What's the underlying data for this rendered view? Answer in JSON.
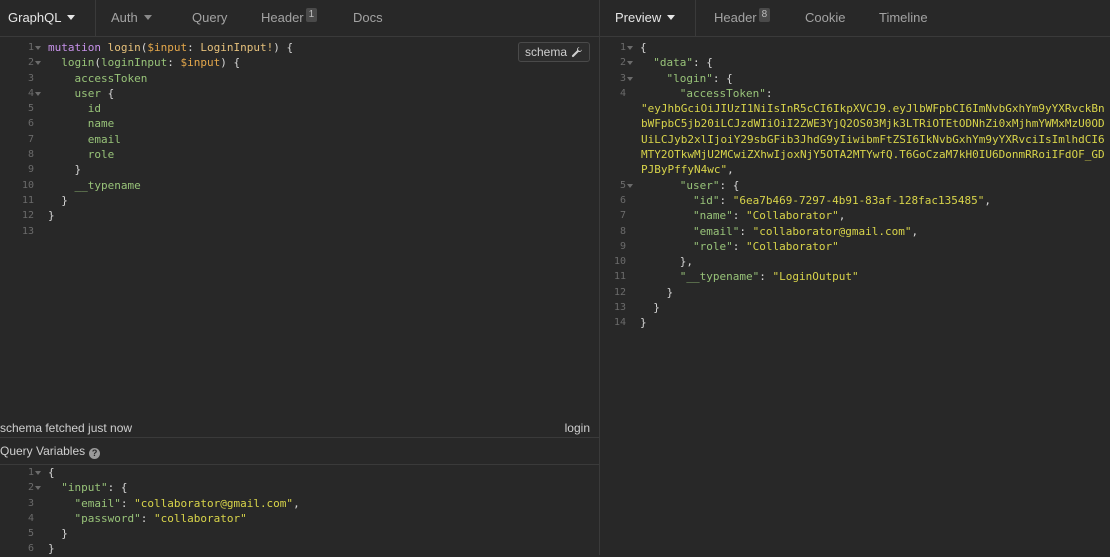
{
  "left_tabs": {
    "graphql": "GraphQL",
    "auth": "Auth",
    "query": "Query",
    "header": "Header",
    "header_count": "1",
    "docs": "Docs"
  },
  "right_tabs": {
    "preview": "Preview",
    "header": "Header",
    "header_count": "8",
    "cookie": "Cookie",
    "timeline": "Timeline"
  },
  "schema_button": "schema",
  "status": {
    "left": "schema fetched just now",
    "right": "login"
  },
  "variables_header": "Query Variables",
  "query": {
    "line_numbers": [
      "1",
      "2",
      "3",
      "4",
      "5",
      "6",
      "7",
      "8",
      "9",
      "10",
      "11",
      "12",
      "13"
    ],
    "mutation_kw": "mutation",
    "op_name": "login",
    "var_name": "$input",
    "var_type": "LoginInput!",
    "field_login": "login",
    "arg_name": "loginInput",
    "fields": [
      "accessToken",
      "user",
      "id",
      "name",
      "email",
      "role",
      "__typename"
    ]
  },
  "variables": {
    "line_numbers": [
      "1",
      "2",
      "3",
      "4",
      "5",
      "6"
    ],
    "input_key": "\"input\"",
    "email_key": "\"email\"",
    "email_value": "\"collaborator@gmail.com\"",
    "password_key": "\"password\"",
    "password_value": "\"collaborator\""
  },
  "response": {
    "line_numbers": [
      "1",
      "2",
      "3",
      "4",
      "5",
      "6",
      "7",
      "8",
      "9",
      "10",
      "11",
      "12",
      "13",
      "14"
    ],
    "data_key": "\"data\"",
    "login_key": "\"login\"",
    "access_token_key": "\"accessToken\"",
    "access_token_value": "\"eyJhbGciOiJIUzI1NiIsInR5cCI6IkpXVCJ9.eyJlbWFpbCI6ImNvbGxhYm9yYXRvckBnbWFpbC5jb20iLCJzdWIiOiI2ZWE3YjQ2OS03Mjk3LTRiOTEtODNhZi0xMjhmYWMxMzU0ODUiLCJyb2xlIjoiY29sbGFib3JhdG9yIiwibmFtZSI6IkNvbGxhYm9yYXRvciIsImlhdCI6MTY2OTkwMjU2MCwiZXhwIjoxNjY5OTA2MTYwfQ.T6GoCzaM7kH0IU6DonmRRoiIFdOF_GDPJByPffyN4wc\"",
    "user_key": "\"user\"",
    "id_key": "\"id\"",
    "id_value": "\"6ea7b469-7297-4b91-83af-128fac135485\"",
    "name_key": "\"name\"",
    "name_value": "\"Collaborator\"",
    "email_key": "\"email\"",
    "email_value": "\"collaborator@gmail.com\"",
    "role_key": "\"role\"",
    "role_value": "\"Collaborator\"",
    "typename_key": "\"__typename\"",
    "typename_value": "\"LoginOutput\""
  }
}
